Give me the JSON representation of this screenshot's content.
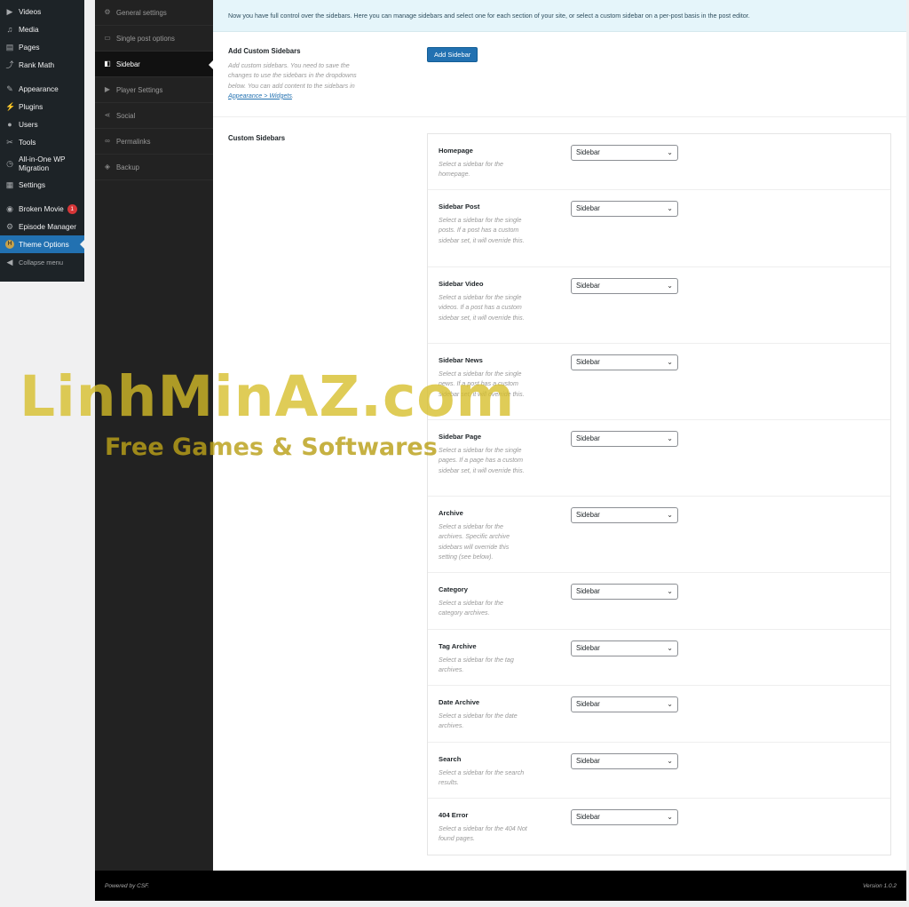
{
  "wp_menu": {
    "items": [
      {
        "label": "Videos",
        "icon": "video-icon"
      },
      {
        "label": "Media",
        "icon": "media-icon"
      },
      {
        "label": "Pages",
        "icon": "pages-icon"
      },
      {
        "label": "Rank Math",
        "icon": "rank-math-icon"
      },
      {
        "label": "Appearance",
        "icon": "appearance-icon"
      },
      {
        "label": "Plugins",
        "icon": "plugins-icon"
      },
      {
        "label": "Users",
        "icon": "users-icon"
      },
      {
        "label": "Tools",
        "icon": "tools-icon"
      },
      {
        "label": "All-in-One WP Migration",
        "icon": "migration-icon"
      },
      {
        "label": "Settings",
        "icon": "settings-icon"
      },
      {
        "label": "Broken Movie",
        "icon": "broken-movie-icon",
        "badge": "1"
      },
      {
        "label": "Episode Manager",
        "icon": "episode-manager-icon"
      },
      {
        "label": "Theme Options",
        "icon": "theme-options-icon",
        "active": true
      },
      {
        "label": "Collapse menu",
        "icon": "collapse-icon"
      }
    ]
  },
  "options_nav": {
    "items": [
      {
        "label": "General settings",
        "icon": "gear-icon"
      },
      {
        "label": "Single post options",
        "icon": "single-post-icon"
      },
      {
        "label": "Sidebar",
        "icon": "sidebar-icon",
        "active": true
      },
      {
        "label": "Player Settings",
        "icon": "player-icon"
      },
      {
        "label": "Social",
        "icon": "share-icon"
      },
      {
        "label": "Permalinks",
        "icon": "link-icon"
      },
      {
        "label": "Backup",
        "icon": "shield-icon"
      }
    ]
  },
  "notice": "Now you have full control over the sidebars. Here you can manage sidebars and select one for each section of your site, or select a custom sidebar on a per-post basis in the post editor.",
  "add_custom": {
    "label": "Add Custom Sidebars",
    "desc_before": "Add custom sidebars. You need to save the changes to use the sidebars in the dropdowns below. You can add content to the sidebars in ",
    "desc_link": "Appearance > Widgets",
    "desc_after": ".",
    "button": "Add Sidebar"
  },
  "custom_sidebars": {
    "label": "Custom Sidebars",
    "rows": [
      {
        "title": "Homepage",
        "desc": "Select a sidebar for the homepage.",
        "value": "Sidebar"
      },
      {
        "title": "Sidebar Post",
        "desc": "Select a sidebar for the single posts. If a post has a custom sidebar set, it will override this.",
        "value": "Sidebar"
      },
      {
        "title": "Sidebar Video",
        "desc": "Select a sidebar for the single videos. If a post has a custom sidebar set, it will override this.",
        "value": "Sidebar"
      },
      {
        "title": "Sidebar News",
        "desc": "Select a sidebar for the single news. If a post has a custom sidebar set, it will override this.",
        "value": "Sidebar"
      },
      {
        "title": "Sidebar Page",
        "desc": "Select a sidebar for the single pages. If a page has a custom sidebar set, it will override this.",
        "value": "Sidebar"
      },
      {
        "title": "Archive",
        "desc": "Select a sidebar for the archives. Specific archive sidebars will override this setting (see below).",
        "value": "Sidebar"
      },
      {
        "title": "Category",
        "desc": "Select a sidebar for the category archives.",
        "value": "Sidebar"
      },
      {
        "title": "Tag Archive",
        "desc": "Select a sidebar for the tag archives.",
        "value": "Sidebar"
      },
      {
        "title": "Date Archive",
        "desc": "Select a sidebar for the date archives.",
        "value": "Sidebar"
      },
      {
        "title": "Search",
        "desc": "Select a sidebar for the search results.",
        "value": "Sidebar"
      },
      {
        "title": "404 Error",
        "desc": "Select a sidebar for the 404 Not found pages.",
        "value": "Sidebar"
      }
    ]
  },
  "footer": {
    "left": "Powered by CSF.",
    "right": "Version 1.0.2"
  },
  "watermark": {
    "title": "LinhMinAZ.com",
    "subtitle": "Free Games & Softwares"
  },
  "colors": {
    "wp_menu_bg": "#1d2327",
    "accent": "#2271b1",
    "options_nav_bg": "#222222",
    "notice_bg": "#e5f5fa",
    "badge": "#d63638"
  }
}
